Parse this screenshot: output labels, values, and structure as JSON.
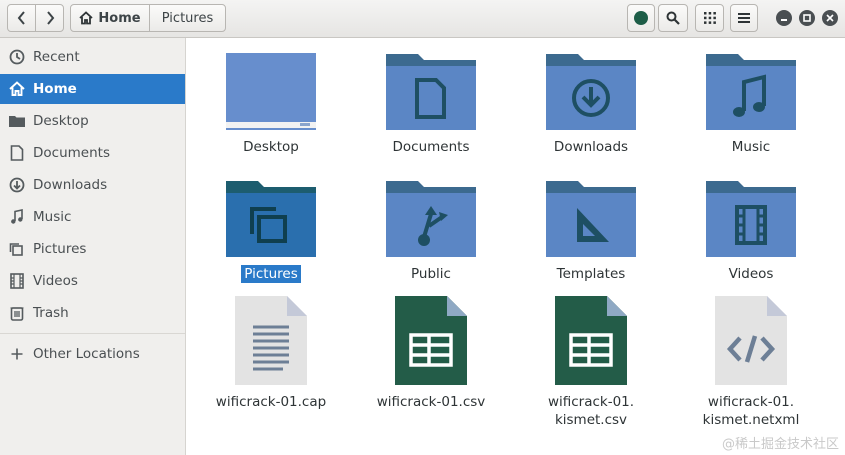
{
  "header": {
    "breadcrumbs": [
      {
        "label": "Home",
        "icon": "home-icon"
      },
      {
        "label": "Pictures"
      }
    ],
    "status_color": "#1d5d47"
  },
  "sidebar": {
    "items": [
      {
        "label": "Recent",
        "icon": "recent-clock-icon"
      },
      {
        "label": "Home",
        "icon": "home-icon",
        "active": true
      },
      {
        "label": "Desktop",
        "icon": "folder-icon"
      },
      {
        "label": "Documents",
        "icon": "document-icon"
      },
      {
        "label": "Downloads",
        "icon": "download-icon"
      },
      {
        "label": "Music",
        "icon": "music-icon"
      },
      {
        "label": "Pictures",
        "icon": "pictures-icon"
      },
      {
        "label": "Videos",
        "icon": "videos-icon"
      },
      {
        "label": "Trash",
        "icon": "trash-icon"
      },
      {
        "label": "Other Locations",
        "icon": "plus-icon"
      }
    ]
  },
  "files": [
    {
      "name": "Desktop",
      "kind": "folder-desktop"
    },
    {
      "name": "Documents",
      "kind": "folder-documents"
    },
    {
      "name": "Downloads",
      "kind": "folder-downloads"
    },
    {
      "name": "Music",
      "kind": "folder-music"
    },
    {
      "name": "Pictures",
      "kind": "folder-pictures",
      "selected": true
    },
    {
      "name": "Public",
      "kind": "folder-public"
    },
    {
      "name": "Templates",
      "kind": "folder-templates"
    },
    {
      "name": "Videos",
      "kind": "folder-videos"
    },
    {
      "name": "wificrack-01.cap",
      "kind": "text-file"
    },
    {
      "name": "wificrack-01.csv",
      "kind": "spreadsheet-file"
    },
    {
      "name": "wificrack-01.\nkismet.csv",
      "kind": "spreadsheet-file"
    },
    {
      "name": "wificrack-01.\nkismet.netxml",
      "kind": "code-file"
    }
  ],
  "colors": {
    "accent": "#2a7ac9",
    "folder_front": "#5b86c5",
    "folder_back": "#3c6a8f",
    "folder_selected_front": "#2a6fae",
    "folder_selected_back": "#1d5d6f",
    "spreadsheet": "#235c48",
    "file_paper": "#e3e3e3"
  },
  "watermark": "@稀土掘金技术社区"
}
